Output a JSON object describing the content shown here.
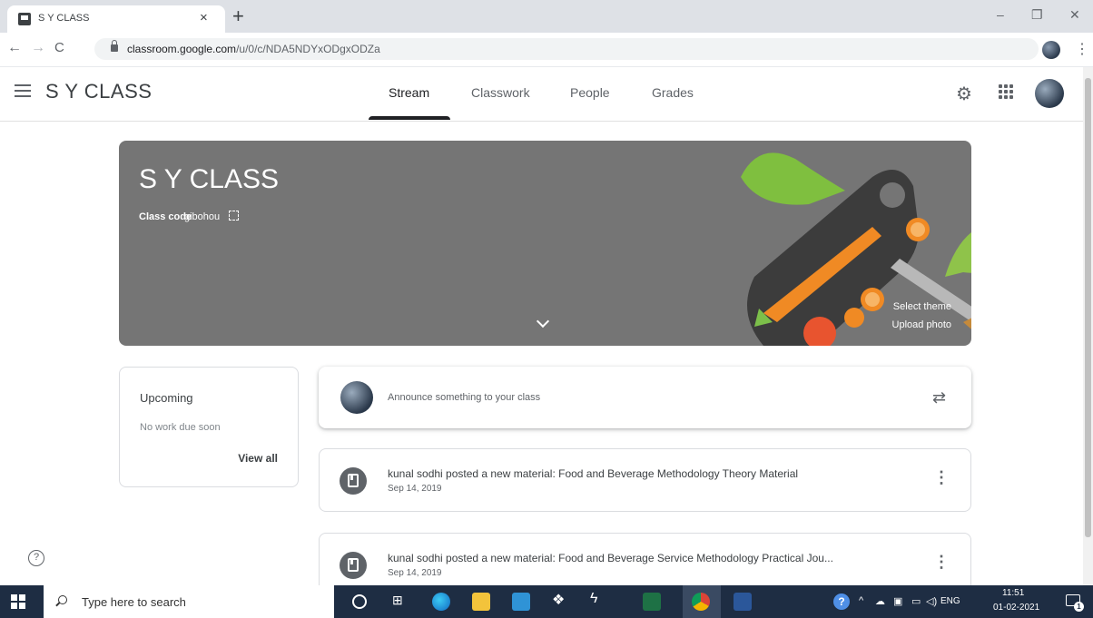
{
  "browser": {
    "tab_title": "S Y CLASS",
    "tab_close": "×",
    "new_tab": "+",
    "url_host": "classroom.google.com",
    "url_path": "/u/0/c/NDA5NDYxODgxODZa",
    "window_min": "–",
    "window_max": "❐",
    "window_close": "✕",
    "back": "←",
    "forward": "→",
    "reload": "C",
    "star": "☆",
    "menu": "⋮"
  },
  "header": {
    "menu_icon": "hamburger-icon",
    "class_name": "S Y CLASS",
    "tabs": [
      {
        "label": "Stream",
        "active": true
      },
      {
        "label": "Classwork",
        "active": false
      },
      {
        "label": "People",
        "active": false
      },
      {
        "label": "Grades",
        "active": false
      }
    ],
    "settings_glyph": "⚙"
  },
  "banner": {
    "title": "S Y CLASS",
    "class_code_label": "Class code",
    "class_code": "gibohou",
    "select_theme": "Select theme",
    "upload_photo": "Upload photo",
    "background_color": "#757575"
  },
  "upcoming": {
    "title": "Upcoming",
    "empty_text": "No work due soon",
    "view_all": "View all"
  },
  "announce": {
    "placeholder": "Announce something to your class",
    "repost_glyph": "⇄"
  },
  "stream": {
    "posts": [
      {
        "title": "kunal sodhi posted a new material: Food and Beverage Methodology Theory Material",
        "date": "Sep 14, 2019"
      },
      {
        "title": "kunal sodhi posted a new material: Food and Beverage Service Methodology Practical Jou...",
        "date": "Sep 14, 2019"
      }
    ],
    "kebab": "⋮"
  },
  "help": {
    "glyph": "?"
  },
  "taskbar": {
    "search_placeholder": "Type here to search",
    "taskview_glyph": "⊞",
    "dropbox_glyph": "❖",
    "winamp_glyph": "ϟ",
    "help_glyph": "?",
    "tray_chevron": "^",
    "tray_cloud": "☁",
    "tray_net": "▣",
    "tray_battery": "▭",
    "tray_volume": "◁)",
    "language": "ENG",
    "time": "11:51",
    "date": "01-02-2021",
    "notifications": "1"
  },
  "colors": {
    "active_tab": "#202124",
    "text_secondary": "#5f6368",
    "taskbar": "#1e2d43"
  }
}
